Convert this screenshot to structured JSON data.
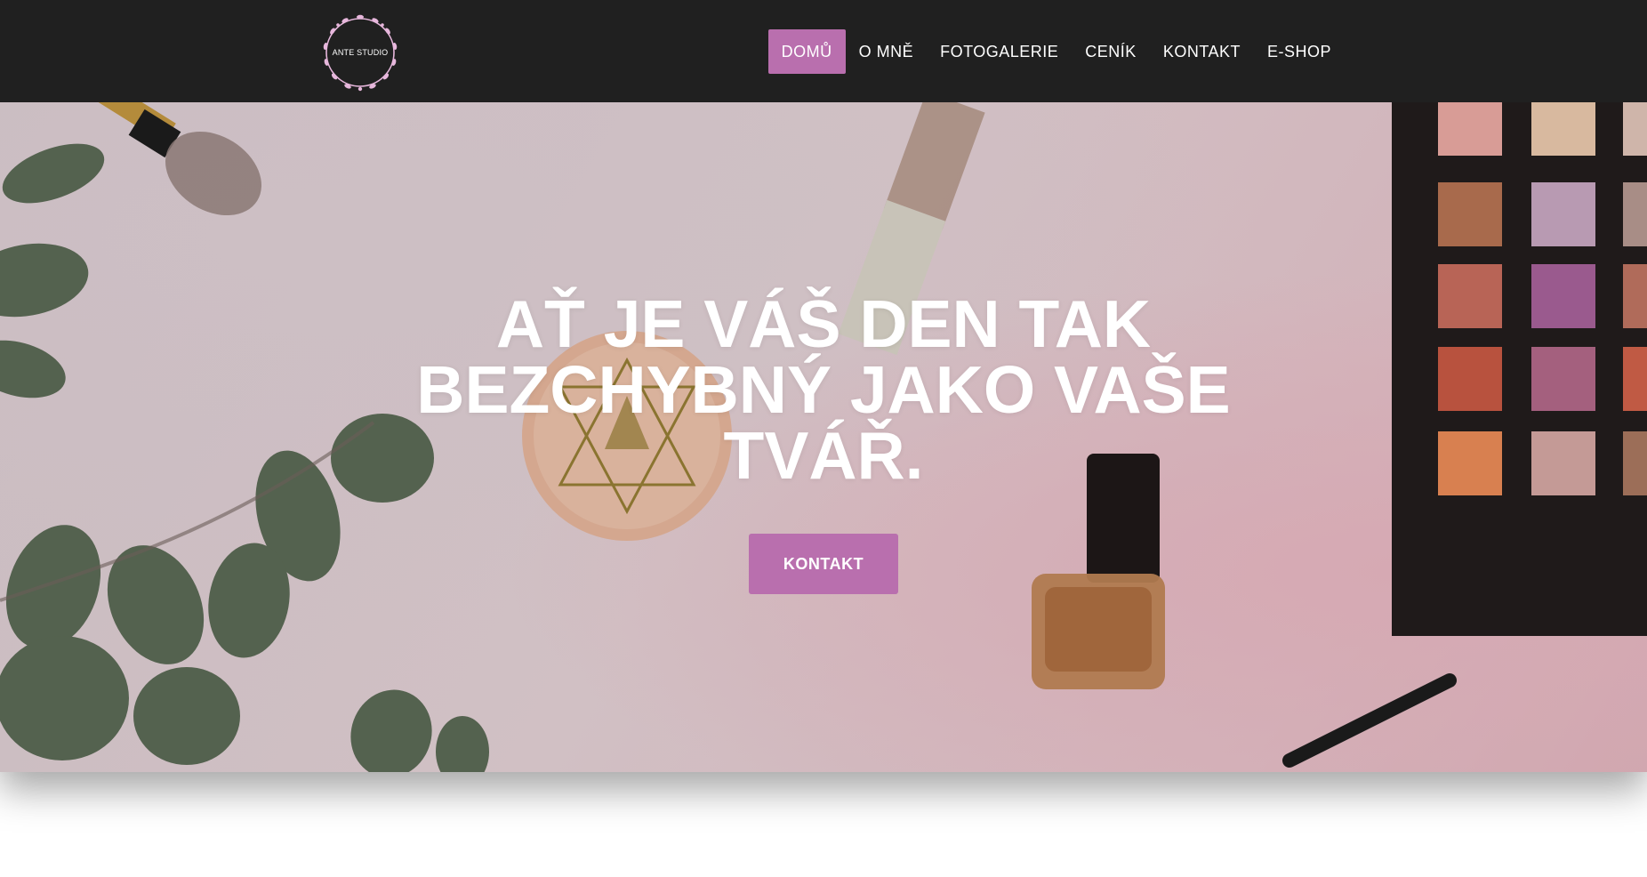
{
  "header": {
    "logo_text": "ANTE STUDIO",
    "nav": [
      {
        "label": "DOMŮ",
        "active": true
      },
      {
        "label": "O MNĚ"
      },
      {
        "label": "FOTOGALERIE"
      },
      {
        "label": "CENÍK"
      },
      {
        "label": "KONTAKT"
      },
      {
        "label": "E-SHOP"
      }
    ]
  },
  "hero": {
    "title": "AŤ JE VÁŠ DEN TAK BEZCHYBNÝ JAKO VAŠE TVÁŘ.",
    "button_label": "KONTAKT"
  },
  "colors": {
    "header_bg": "#202020",
    "accent": "#b96fae",
    "text": "#ffffff"
  }
}
